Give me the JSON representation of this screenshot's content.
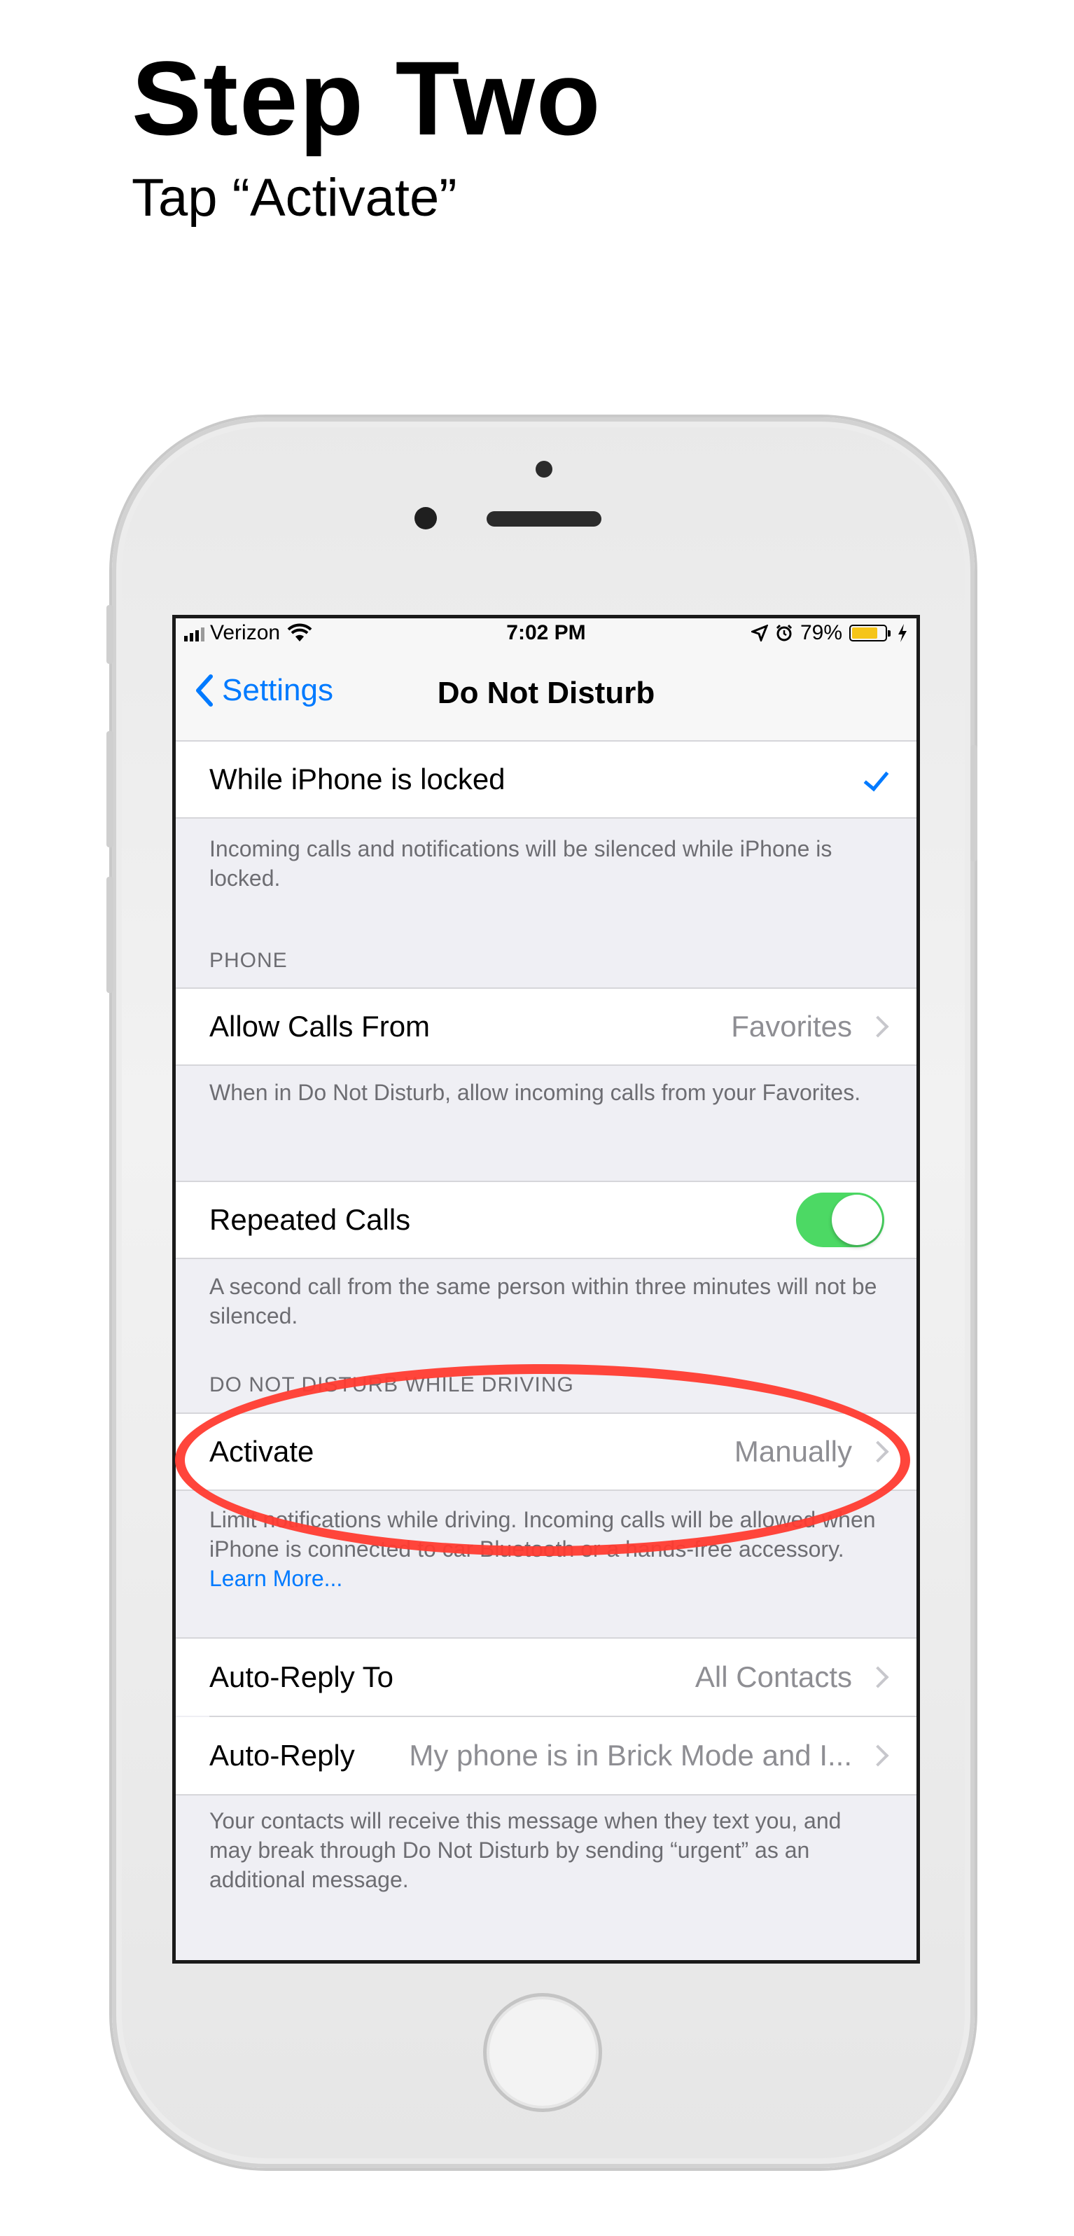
{
  "page": {
    "heading": "Step Two",
    "subheading": "Tap “Activate”"
  },
  "status_bar": {
    "carrier": "Verizon",
    "time": "7:02 PM",
    "battery": "79%",
    "icons": [
      "signal-icon",
      "wifi-icon",
      "location-icon",
      "alarm-icon",
      "battery-icon",
      "charging-icon"
    ],
    "battery_level": 0.79,
    "battery_color": "#f5c518"
  },
  "nav": {
    "back_label": "Settings",
    "title": "Do Not Disturb"
  },
  "silence": {
    "option_label": "While iPhone is locked",
    "footer": "Incoming calls and notifications will be silenced while iPhone is locked."
  },
  "phone_section": {
    "header": "PHONE",
    "allow_calls_label": "Allow Calls From",
    "allow_calls_value": "Favorites",
    "allow_calls_footer": "When in Do Not Disturb, allow incoming calls from your Favorites.",
    "repeated_calls_label": "Repeated Calls",
    "repeated_calls_on": true,
    "repeated_calls_footer": "A second call from the same person within three minutes will not be silenced."
  },
  "driving_section": {
    "header": "DO NOT DISTURB WHILE DRIVING",
    "activate_label": "Activate",
    "activate_value": "Manually",
    "footer_text": "Limit notifications while driving. Incoming calls will be allowed when iPhone is connected to car Bluetooth or a hands-free accessory.",
    "learn_more": "Learn More...",
    "auto_reply_to_label": "Auto-Reply To",
    "auto_reply_to_value": "All Contacts",
    "auto_reply_label": "Auto-Reply",
    "auto_reply_value": "My phone is in Brick Mode and I...",
    "auto_reply_footer": "Your contacts will receive this message when they text you, and may break through Do Not Disturb by sending “urgent” as an additional message."
  },
  "colors": {
    "accent": "#007aff",
    "toggle_on": "#4cd964",
    "highlight": "#ff3b30"
  }
}
